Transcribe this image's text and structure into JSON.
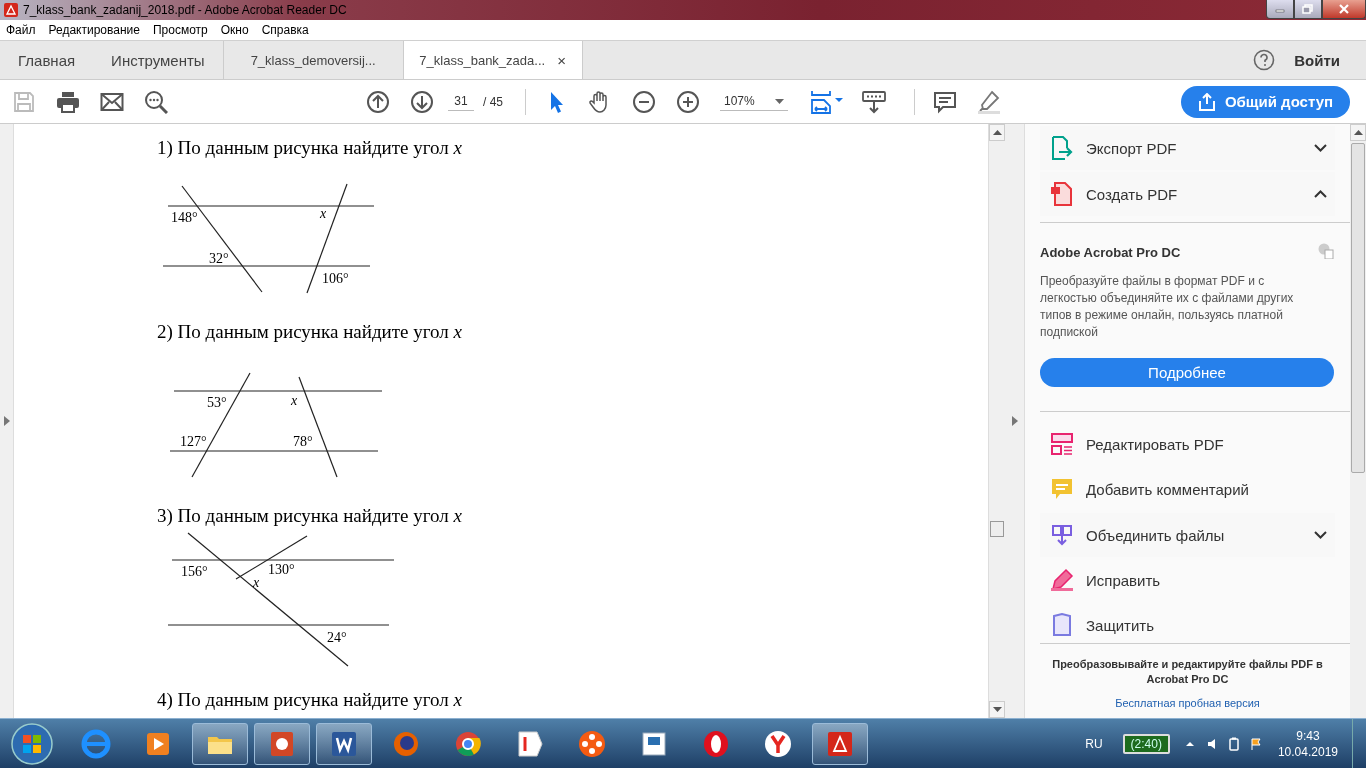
{
  "window": {
    "title": "7_klass_bank_zadanij_2018.pdf - Adobe Acrobat Reader DC"
  },
  "menu": [
    "Файл",
    "Редактирование",
    "Просмотр",
    "Окно",
    "Справка"
  ],
  "tabs": [
    {
      "label": "Главная",
      "selected": false,
      "kind": "nav"
    },
    {
      "label": "Инструменты",
      "selected": false,
      "kind": "nav"
    },
    {
      "label": "7_klass_demoversij...",
      "selected": false,
      "kind": "doc"
    },
    {
      "label": "7_klass_bank_zada...",
      "selected": true,
      "kind": "doc",
      "close": "×"
    }
  ],
  "signin": "Войти",
  "toolbar": {
    "save_disabled": true,
    "page": "31",
    "page_total": "/ 45",
    "zoom": "107%",
    "tool_select_selected": true,
    "share": "Общий доступ"
  },
  "problems": [
    {
      "heading": "1) По данным рисунка найдите угол *x*",
      "labels": [
        {
          "text": "148°",
          "kind": "angle"
        },
        {
          "text": "32°",
          "kind": "angle"
        },
        {
          "text": "x",
          "kind": "variable"
        },
        {
          "text": "106°",
          "kind": "angle"
        }
      ]
    },
    {
      "heading": "2) По данным рисунка найдите угол *x*",
      "labels": [
        {
          "text": "53°",
          "kind": "angle"
        },
        {
          "text": "x",
          "kind": "variable"
        },
        {
          "text": "127°",
          "kind": "angle"
        },
        {
          "text": "78°",
          "kind": "angle"
        }
      ]
    },
    {
      "heading": "3) По данным рисунка найдите угол *x*",
      "labels": [
        {
          "text": "156°",
          "kind": "angle"
        },
        {
          "text": "130°",
          "kind": "angle"
        },
        {
          "text": "x",
          "kind": "variable"
        },
        {
          "text": "24°",
          "kind": "angle"
        }
      ]
    },
    {
      "heading": "4) По данным рисунка найдите угол *x*"
    }
  ],
  "panel": {
    "tools_top": [
      {
        "label": "Экспорт PDF",
        "expanded": false
      },
      {
        "label": "Создать PDF",
        "expanded": true
      }
    ],
    "promo": {
      "title": "Adobe Acrobat Pro DC",
      "text": "Преобразуйте файлы в формат PDF и с легкостью объединяйте их с файлами других типов в режиме онлайн, пользуясь платной подпиской",
      "button": "Подробнее"
    },
    "tools": [
      {
        "label": "Редактировать PDF"
      },
      {
        "label": "Добавить комментарий"
      },
      {
        "label": "Объединить файлы",
        "expanded": false
      },
      {
        "label": "Исправить"
      },
      {
        "label": "Защитить"
      }
    ],
    "footer": {
      "text": "Преобразовывайте и редактируйте файлы PDF в Acrobat Pro DC",
      "link": "Бесплатная пробная версия"
    }
  },
  "taskbar": {
    "apps": [
      {
        "open": false
      },
      {
        "open": false
      },
      {
        "open": true
      },
      {
        "open": true
      },
      {
        "open": true
      },
      {
        "open": false
      },
      {
        "open": false
      },
      {
        "open": false
      },
      {
        "open": false
      },
      {
        "open": false
      },
      {
        "open": false
      },
      {
        "open": false
      },
      {
        "open": true
      }
    ],
    "lang": "RU",
    "battery": "(2:40)",
    "time": "9:43",
    "date": "10.04.2019"
  }
}
